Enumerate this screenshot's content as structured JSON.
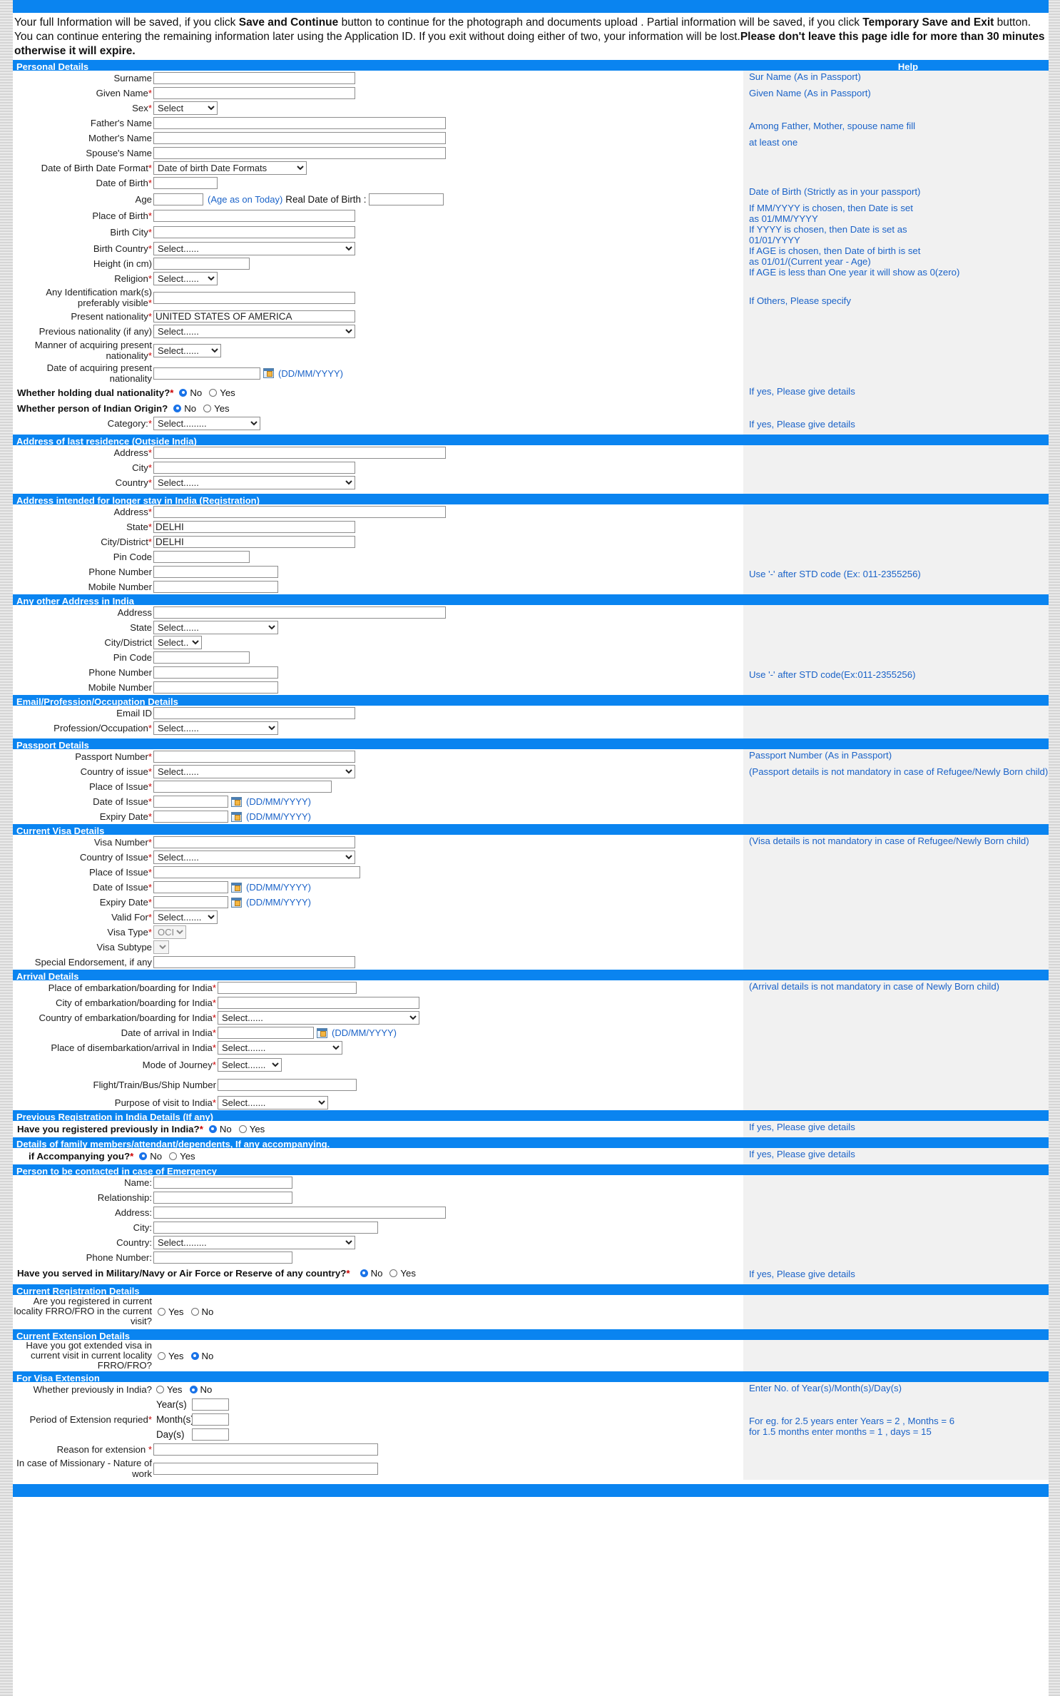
{
  "notice": {
    "part1": "Your full Information will be saved, if you click ",
    "bold1": "Save and Continue",
    "part2": " button to continue for the photograph and documents upload . Partial information will be saved, if you click ",
    "bold2": "Temporary Save and Exit",
    "part3": " button. You can continue entering the remaining information later using the Application ID. If you exit without doing either of two, your information will be lost.",
    "bold3": "Please don't leave this page idle for more than 30 minutes otherwise it will expire."
  },
  "help_header": "Help",
  "sections": {
    "personal": "Personal Details",
    "last_residence": "Address of last residence (Outside India)",
    "longer_stay": "Address intended for longer stay in India (Registration)",
    "other_address": "Any other Address in India",
    "email_profession": "Email/Profession/Occupation Details",
    "passport": "Passport Details",
    "current_visa": "Current Visa Details",
    "arrival": "Arrival Details",
    "previous_registration": "Previous Registration in India Details (If any)",
    "family_members": "Details of family members/attendant/dependents, If any accompanying.",
    "emergency": "Person to be contacted in case of Emergency",
    "current_registration": "Current Registration Details",
    "current_extension": "Current Extension Details",
    "visa_extension": "For Visa Extension"
  },
  "personal": {
    "surname": {
      "label": "Surname",
      "value": "",
      "required": false
    },
    "given_name": {
      "label": "Given Name",
      "value": "",
      "required": true
    },
    "sex": {
      "label": "Sex",
      "value": "Select",
      "required": true
    },
    "fathers_name": {
      "label": "Father's Name",
      "value": "",
      "required": false
    },
    "mothers_name": {
      "label": "Mother's Name",
      "value": "",
      "required": false
    },
    "spouses_name": {
      "label": "Spouse's Name",
      "value": "",
      "required": false
    },
    "dob_format": {
      "label": "Date of Birth Date Format",
      "value": "Date of birth Date Formats",
      "required": true
    },
    "dob": {
      "label": "Date of Birth",
      "value": "",
      "required": true
    },
    "age": {
      "label": "Age",
      "value": "",
      "required": false
    },
    "age_note": "(Age as on Today)",
    "real_dob_label": "Real Date of Birth :",
    "real_dob_value": "",
    "place_of_birth": {
      "label": "Place of Birth",
      "value": "",
      "required": true
    },
    "birth_city": {
      "label": "Birth City",
      "value": "",
      "required": true
    },
    "birth_country": {
      "label": "Birth Country",
      "value": "Select......",
      "required": true
    },
    "height": {
      "label": "Height (in cm)",
      "value": "",
      "required": false
    },
    "religion": {
      "label": "Religion",
      "value": "Select......",
      "required": true
    },
    "identification_mark": {
      "label": "Any Identification mark(s) preferably visible",
      "value": "",
      "required": true
    },
    "present_nationality": {
      "label": "Present nationality",
      "value": "UNITED STATES OF AMERICA",
      "required": true
    },
    "previous_nationality": {
      "label": "Previous nationality (if any)",
      "value": "Select......",
      "required": false
    },
    "manner_acquiring": {
      "label": "Manner of acquiring present nationality",
      "value": "Select......",
      "required": true
    },
    "date_acquiring": {
      "label": "Date of acquiring present nationality",
      "value": "",
      "format": "(DD/MM/YYYY)"
    },
    "dual_nationality": {
      "label": "Whether holding dual nationality?",
      "required": true,
      "selected": "No",
      "options": [
        "No",
        "Yes"
      ]
    },
    "indian_origin": {
      "label": "Whether person of Indian Origin?",
      "required": false,
      "selected": "No",
      "options": [
        "No",
        "Yes"
      ]
    },
    "category": {
      "label": "Category:",
      "value": "Select.........",
      "required": true
    }
  },
  "last_residence": {
    "address": {
      "label": "Address",
      "value": "",
      "required": true
    },
    "city": {
      "label": "City",
      "value": "",
      "required": true
    },
    "country": {
      "label": "Country",
      "value": "Select......",
      "required": true
    }
  },
  "longer_stay": {
    "address": {
      "label": "Address",
      "value": "",
      "required": true
    },
    "state": {
      "label": "State",
      "value": "DELHI",
      "required": true
    },
    "city_district": {
      "label": "City/District",
      "value": "DELHI",
      "required": true
    },
    "pin_code": {
      "label": "Pin Code",
      "value": "",
      "required": false
    },
    "phone": {
      "label": "Phone Number",
      "value": "",
      "required": false
    },
    "mobile": {
      "label": "Mobile Number",
      "value": "",
      "required": false
    }
  },
  "other_address": {
    "address": {
      "label": "Address",
      "value": "",
      "required": false
    },
    "state": {
      "label": "State",
      "value": "Select......",
      "required": false
    },
    "city_district": {
      "label": "City/District",
      "value": "Select......",
      "required": false
    },
    "pin_code": {
      "label": "Pin Code",
      "value": "",
      "required": false
    },
    "phone": {
      "label": "Phone Number",
      "value": "",
      "required": false
    },
    "mobile": {
      "label": "Mobile Number",
      "value": "",
      "required": false
    }
  },
  "email_profession": {
    "email": {
      "label": "Email ID",
      "value": "",
      "required": false
    },
    "profession": {
      "label": "Profession/Occupation",
      "value": "Select......",
      "required": true
    }
  },
  "passport": {
    "number": {
      "label": "Passport Number",
      "value": "",
      "required": true
    },
    "country_of_issue": {
      "label": "Country of issue",
      "value": "Select......",
      "required": true
    },
    "place_of_issue": {
      "label": "Place of Issue",
      "value": "",
      "required": true
    },
    "date_of_issue": {
      "label": "Date of Issue",
      "value": "",
      "required": true,
      "format": "(DD/MM/YYYY)"
    },
    "expiry_date": {
      "label": "Expiry Date",
      "value": "",
      "required": true,
      "format": "(DD/MM/YYYY)"
    }
  },
  "current_visa": {
    "visa_number": {
      "label": "Visa Number",
      "value": "",
      "required": true
    },
    "country_of_issue": {
      "label": "Country of Issue",
      "value": "Select......",
      "required": true
    },
    "place_of_issue": {
      "label": "Place of Issue",
      "value": "",
      "required": true
    },
    "date_of_issue": {
      "label": "Date of Issue",
      "value": "",
      "required": true,
      "format": "(DD/MM/YYYY)"
    },
    "expiry_date": {
      "label": "Expiry Date",
      "value": "",
      "required": true,
      "format": "(DD/MM/YYYY)"
    },
    "valid_for": {
      "label": "Valid For",
      "value": "Select.......",
      "required": true
    },
    "visa_type": {
      "label": "Visa Type",
      "value": "OCI",
      "required": true
    },
    "visa_subtype": {
      "label": "Visa Subtype",
      "value": "",
      "required": false
    },
    "special_endorsement": {
      "label": "Special Endorsement, if any",
      "value": "",
      "required": false
    }
  },
  "arrival": {
    "place_embarkation": {
      "label": "Place of embarkation/boarding for India",
      "value": "",
      "required": true
    },
    "city_embarkation": {
      "label": "City of embarkation/boarding for India",
      "value": "",
      "required": true
    },
    "country_embarkation": {
      "label": "Country of embarkation/boarding for India",
      "value": "Select......",
      "required": true
    },
    "date_arrival": {
      "label": "Date of arrival in India",
      "value": "",
      "required": true,
      "format": "(DD/MM/YYYY)"
    },
    "place_disembarkation": {
      "label": "Place of disembarkation/arrival in India",
      "value": "Select.......",
      "required": true
    },
    "mode_journey": {
      "label": "Mode of Journey",
      "value": "Select.......",
      "required": true
    },
    "flight_number": {
      "label": "Flight/Train/Bus/Ship Number",
      "value": "",
      "required": false
    },
    "purpose": {
      "label": "Purpose of visit to India",
      "value": "Select.......",
      "required": true
    }
  },
  "previous_registration": {
    "question": {
      "label": "Have you registered previously in India?",
      "required": true,
      "selected": "No",
      "options": [
        "No",
        "Yes"
      ]
    }
  },
  "family_members": {
    "question": {
      "label": "if Accompanying you?",
      "required": true,
      "selected": "No",
      "options": [
        "No",
        "Yes"
      ]
    }
  },
  "emergency": {
    "name": {
      "label": "Name:",
      "value": ""
    },
    "relationship": {
      "label": "Relationship:",
      "value": ""
    },
    "address": {
      "label": "Address:",
      "value": ""
    },
    "city": {
      "label": "City:",
      "value": ""
    },
    "country": {
      "label": "Country:",
      "value": "Select........."
    },
    "phone": {
      "label": "Phone Number:",
      "value": ""
    },
    "military": {
      "label": "Have you served in Military/Navy or Air Force or Reserve of any country?",
      "required": true,
      "selected": "No",
      "options": [
        "No",
        "Yes"
      ]
    }
  },
  "current_registration": {
    "question": {
      "label": "Are you registered\nin current locality FRRO/FRO\nin the current visit?",
      "selected": "",
      "options": [
        "Yes",
        "No"
      ]
    }
  },
  "current_extension": {
    "question": {
      "label": "Have you got extended visa in\ncurrent visit in current locality FRRO/FRO?",
      "selected": "No",
      "options": [
        "Yes",
        "No"
      ]
    }
  },
  "visa_extension": {
    "previously_in_india": {
      "label": "Whether previously in India?",
      "selected": "No",
      "options": [
        "Yes",
        "No"
      ]
    },
    "period_label": "Period of Extension requried",
    "period_required": true,
    "years": {
      "label": "Year(s)",
      "value": ""
    },
    "months": {
      "label": "Month(s)",
      "value": ""
    },
    "days": {
      "label": "Day(s)",
      "value": ""
    },
    "reason": {
      "label": "Reason for extension ",
      "value": "",
      "required": true
    },
    "missionary": {
      "label": "In case of Missionary - Nature of work",
      "value": ""
    }
  },
  "help": {
    "surname": "Sur Name (As in Passport)",
    "given_name": "Given Name (As in Passport)",
    "parents_1": "Among Father, Mother, spouse name fill",
    "parents_2": "at least one",
    "dob": "Date of Birth (Strictly as in your passport)",
    "dob_rules": "If MM/YYYY is chosen, then Date is set\nas 01/MM/YYYY\nIf YYYY is chosen, then Date is set as\n01/01/YYYY\nIf AGE is chosen, then Date of birth is set\nas 01/01/(Current year - Age)\nIf AGE is less than One year it will show as 0(zero)",
    "religion": "If Others, Please specify",
    "dual_nationality": "If yes, Please give details",
    "indian_origin": "If yes, Please give details",
    "std_code_1": "Use '-' after STD code (Ex: 011-2355256)",
    "std_code_2": "Use '-' after STD code(Ex:011-2355256)",
    "passport_number": "Passport Number (As in Passport)",
    "passport_note": "(Passport details is not mandatory in case of Refugee/Newly Born child)",
    "visa_note": "(Visa details is not mandatory in case of Refugee/Newly Born child)",
    "arrival_note": "(Arrival details is not mandatory in case of Newly Born child)",
    "prev_reg": "If yes, Please give details",
    "family": "If yes, Please give details",
    "military": "If yes, Please give details",
    "extension_1": "Enter No. of Year(s)/Month(s)/Day(s)",
    "extension_2": "For eg. for 2.5 years enter Years = 2 , Months = 6\nfor 1.5 months enter months = 1 , days = 15"
  },
  "colors": {
    "accent": "#0a84f0",
    "help_text": "#1b63c8",
    "required": "#cc0000"
  }
}
